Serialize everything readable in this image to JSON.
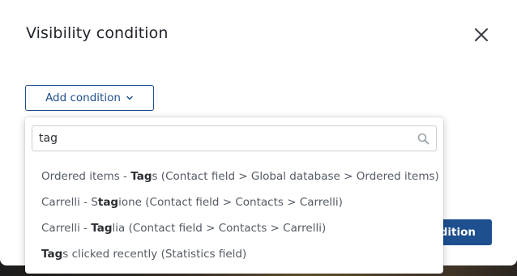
{
  "modal": {
    "title": "Visibility condition",
    "add_condition_label": "Add condition",
    "primary_button_label": "ndition"
  },
  "search": {
    "value": "tag"
  },
  "options": [
    {
      "pre": "Ordered items - ",
      "match": "Tag",
      "post": "s (Contact field > Global database > Ordered items)"
    },
    {
      "pre": "Carrelli - S",
      "match": "tag",
      "post": "ione (Contact field > Contacts > Carrelli)"
    },
    {
      "pre": "Carrelli - ",
      "match": "Tag",
      "post": "lia (Contact field > Contacts > Carrelli)"
    },
    {
      "pre": "",
      "match": "Tag",
      "post": "s clicked recently (Statistics field)"
    }
  ],
  "icons": {
    "close": "close-icon",
    "chevron": "chevron-down-icon",
    "search": "search-icon"
  },
  "colors": {
    "accent": "#1e4f8f",
    "text": "#1f2329",
    "muted": "#545b64"
  }
}
